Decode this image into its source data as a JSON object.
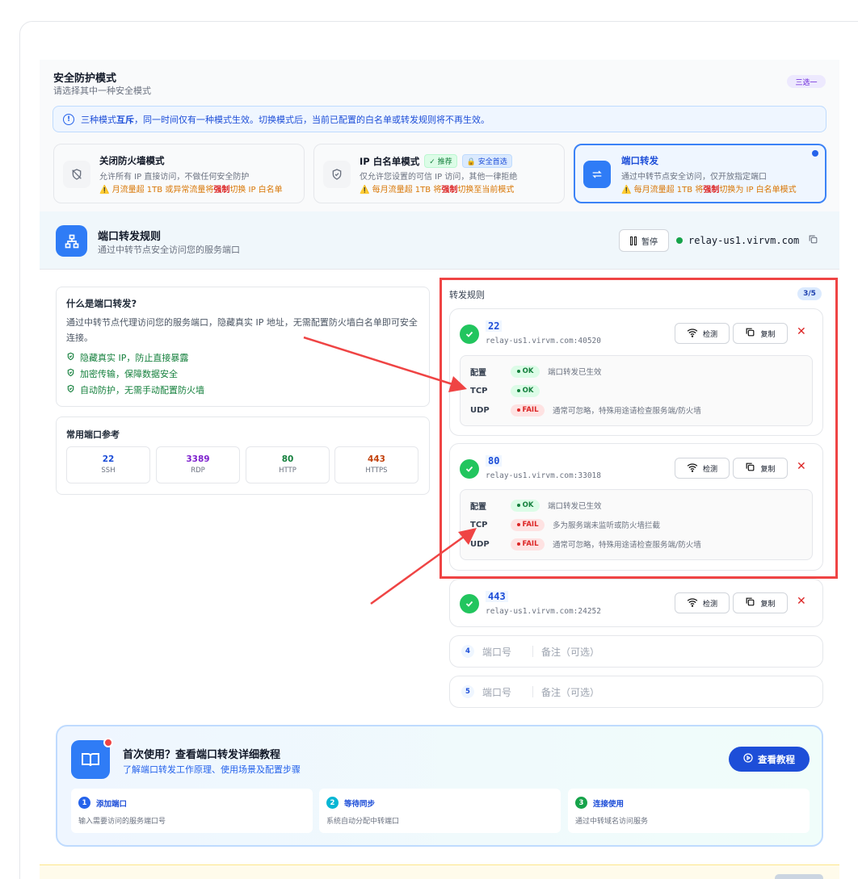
{
  "mode": {
    "title": "安全防护模式",
    "subtitle": "请选择其中一种安全模式",
    "badge": "三选一",
    "info_pre": "三种模式",
    "info_bold": "互斥",
    "info_post": "，同一时间仅有一种模式生效。切换模式后，当前已配置的白名单或转发规则将不再生效。",
    "cards": [
      {
        "title": "关闭防火墙模式",
        "desc": "允许所有 IP 直接访问，不做任何安全防护",
        "warn_pre": "⚠️ 月流量超 1TB 或异常流量将",
        "warn_bold": "强制",
        "warn_post": "切换 IP 白名单"
      },
      {
        "title": "IP 白名单模式",
        "tag1": "推荐",
        "tag2": "安全首选",
        "desc": "仅允许您设置的可信 IP 访问，其他一律拒绝",
        "warn_pre": "⚠️ 每月流量超 1TB 将",
        "warn_bold": "强制",
        "warn_post": "切换至当前模式"
      },
      {
        "title": "端口转发",
        "desc": "通过中转节点安全访问，仅开放指定端口",
        "warn_pre": "⚠️ 每月流量超 1TB 将",
        "warn_bold": "强制",
        "warn_post": "切换为 IP 白名单模式"
      }
    ]
  },
  "header": {
    "title": "端口转发规则",
    "subtitle": "通过中转节点安全访问您的服务端口",
    "pause_label": "暂停",
    "relay_host": "relay-us1.virvm.com"
  },
  "about": {
    "title": "什么是端口转发?",
    "desc": "通过中转节点代理访问您的服务端口，隐藏真实 IP 地址，无需配置防火墙白名单即可安全连接。",
    "points": [
      "隐藏真实 IP，防止直接暴露",
      "加密传输，保障数据安全",
      "自动防护，无需手动配置防火墙"
    ]
  },
  "common": {
    "title": "常用端口参考",
    "ports": [
      {
        "num": "22",
        "label": "SSH",
        "color": "#1d4ed8"
      },
      {
        "num": "3389",
        "label": "RDP",
        "color": "#7e22ce"
      },
      {
        "num": "80",
        "label": "HTTP",
        "color": "#15803d"
      },
      {
        "num": "443",
        "label": "HTTPS",
        "color": "#c2410c"
      }
    ]
  },
  "rules": {
    "title": "转发规则",
    "count": "3/5",
    "detect_label": "检测",
    "copy_label": "复制",
    "items": [
      {
        "port": "22",
        "host": "relay-us1.virvm.com:40520",
        "checks": [
          {
            "key": "配置",
            "status": "OK",
            "msg": "端口转发已生效"
          },
          {
            "key": "TCP",
            "status": "OK",
            "msg": ""
          },
          {
            "key": "UDP",
            "status": "FAIL",
            "msg": "通常可忽略，特殊用途请检查服务端/防火墙"
          }
        ]
      },
      {
        "port": "80",
        "host": "relay-us1.virvm.com:33018",
        "checks": [
          {
            "key": "配置",
            "status": "OK",
            "msg": "端口转发已生效"
          },
          {
            "key": "TCP",
            "status": "FAIL",
            "msg": "多为服务端未监听或防火墙拦截"
          },
          {
            "key": "UDP",
            "status": "FAIL",
            "msg": "通常可忽略，特殊用途请检查服务端/防火墙"
          }
        ]
      },
      {
        "port": "443",
        "host": "relay-us1.virvm.com:24252"
      }
    ],
    "empty": [
      {
        "num": "4",
        "port_placeholder": "端口号",
        "note_placeholder": "备注（可选）"
      },
      {
        "num": "5",
        "port_placeholder": "端口号",
        "note_placeholder": "备注（可选）"
      }
    ]
  },
  "tutorial": {
    "title": "首次使用？查看端口转发详细教程",
    "subtitle": "了解端口转发工作原理、使用场景及配置步骤",
    "button": "查看教程",
    "steps": [
      {
        "num": "1",
        "title": "添加端口",
        "desc": "输入需要访问的服务端口号",
        "color": "#2563eb"
      },
      {
        "num": "2",
        "title": "等待同步",
        "desc": "系统自动分配中转端口",
        "color": "#06b6d4"
      },
      {
        "num": "3",
        "title": "连接使用",
        "desc": "通过中转域名访问服务",
        "color": "#16a34a"
      }
    ]
  }
}
